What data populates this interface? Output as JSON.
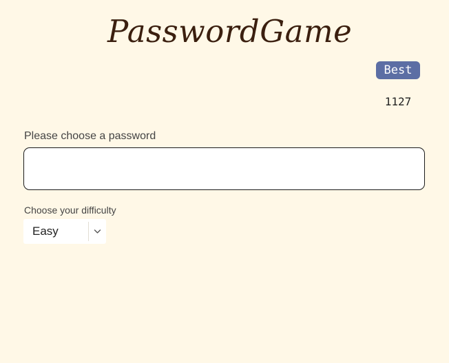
{
  "header": {
    "logo_text": "PasswordGame"
  },
  "best": {
    "label": "Best",
    "score": "1127"
  },
  "password": {
    "label": "Please choose a password",
    "value": "",
    "placeholder": ""
  },
  "difficulty": {
    "label": "Choose your difficulty",
    "selected": "Easy"
  },
  "colors": {
    "background": "#fff8e7",
    "logo": "#3b1f0f",
    "badge": "#5c6ea4"
  },
  "icons": {
    "dropdown": "chevron-down-icon"
  }
}
